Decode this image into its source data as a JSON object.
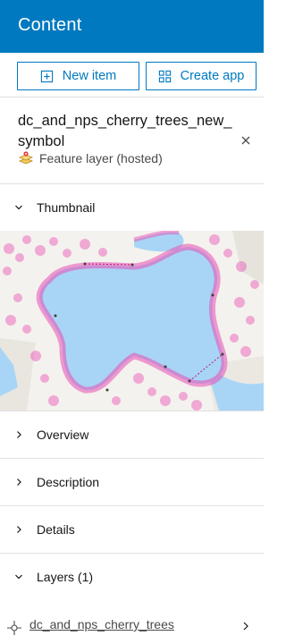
{
  "header": {
    "title": "Content"
  },
  "actions": {
    "new_item": "New item",
    "create_app": "Create app"
  },
  "item": {
    "title": "dc_and_nps_cherry_trees_new_symbol",
    "type": "Feature layer (hosted)"
  },
  "sections": {
    "thumbnail": "Thumbnail",
    "overview": "Overview",
    "description": "Description",
    "details": "Details",
    "layers": "Layers (1)"
  },
  "layers": [
    {
      "name": "dc_and_nps_cherry_trees"
    }
  ],
  "colors": {
    "brand": "#0079c1",
    "water": "#a8d5f5",
    "blossom": "#e84fb4"
  }
}
